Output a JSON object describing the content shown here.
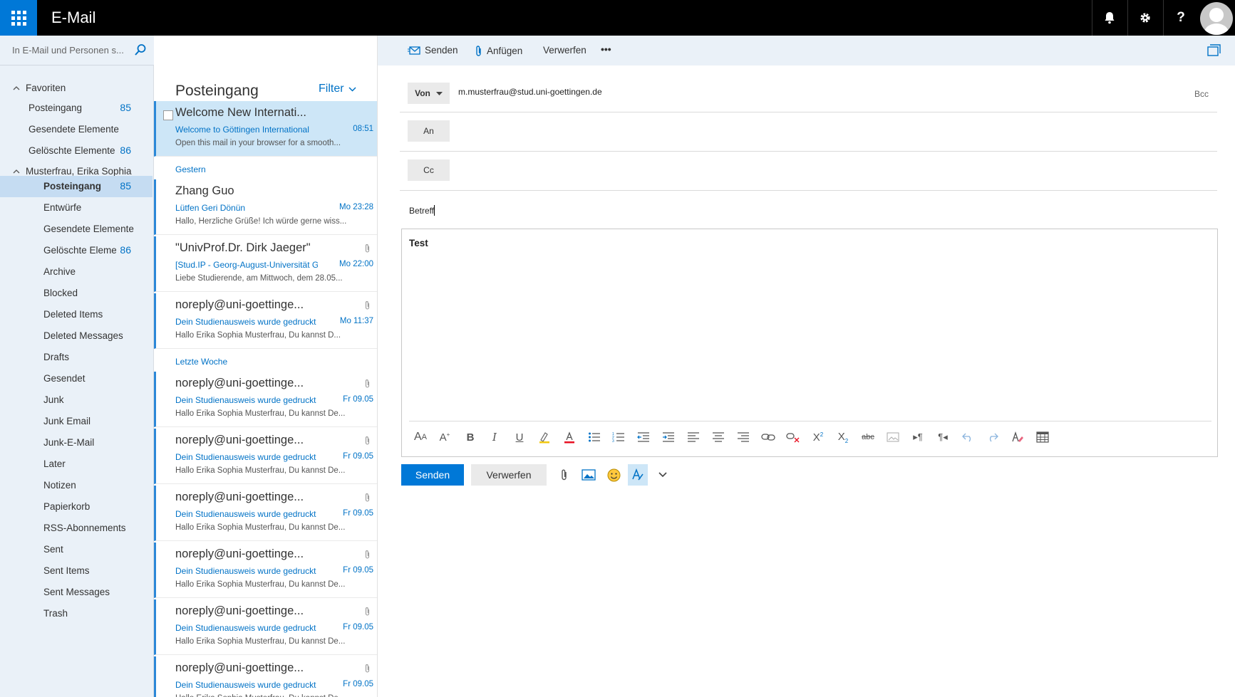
{
  "header": {
    "app_title": "E-Mail"
  },
  "search": {
    "placeholder": "In E-Mail und Personen s..."
  },
  "sidebar": {
    "favorites_label": "Favoriten",
    "favorites": [
      {
        "label": "Posteingang",
        "count": "85"
      },
      {
        "label": "Gesendete Elemente",
        "count": ""
      },
      {
        "label": "Gelöschte Elemente",
        "count": "86"
      }
    ],
    "account_label": "Musterfrau, Erika Sophia",
    "folders": [
      {
        "label": "Posteingang",
        "count": "85"
      },
      {
        "label": "Entwürfe",
        "count": ""
      },
      {
        "label": "Gesendete Elemente",
        "count": ""
      },
      {
        "label": "Gelöschte Elemente",
        "count": "86"
      },
      {
        "label": "Archive",
        "count": ""
      },
      {
        "label": "Blocked",
        "count": ""
      },
      {
        "label": "Deleted Items",
        "count": ""
      },
      {
        "label": "Deleted Messages",
        "count": ""
      },
      {
        "label": "Drafts",
        "count": ""
      },
      {
        "label": "Gesendet",
        "count": ""
      },
      {
        "label": "Junk",
        "count": ""
      },
      {
        "label": "Junk Email",
        "count": ""
      },
      {
        "label": "Junk-E-Mail",
        "count": ""
      },
      {
        "label": "Later",
        "count": ""
      },
      {
        "label": "Notizen",
        "count": ""
      },
      {
        "label": "Papierkorb",
        "count": ""
      },
      {
        "label": "RSS-Abonnements",
        "count": ""
      },
      {
        "label": "Sent",
        "count": ""
      },
      {
        "label": "Sent Items",
        "count": ""
      },
      {
        "label": "Sent Messages",
        "count": ""
      },
      {
        "label": "Trash",
        "count": ""
      }
    ]
  },
  "message_list": {
    "title": "Posteingang",
    "filter_label": "Filter",
    "section_yesterday": "Gestern",
    "section_last_week": "Letzte Woche",
    "messages": [
      {
        "from": "Welcome New Internati...",
        "subject": "Welcome to Göttingen International",
        "time": "08:51",
        "preview": "Open this mail in your browser for a smooth...",
        "attachment": false
      },
      {
        "from": "Zhang Guo",
        "subject": "Lütfen Geri Dönün",
        "time": "Mo 23:28",
        "preview": "Hallo, Herzliche Grüße! Ich würde gerne wiss...",
        "attachment": false
      },
      {
        "from": "\"UnivProf.Dr. Dirk Jaeger\"",
        "subject": "[Stud.IP - Georg-August-Universität G",
        "time": "Mo 22:00",
        "preview": "Liebe Studierende, am Mittwoch, dem 28.05...",
        "attachment": true
      },
      {
        "from": "noreply@uni-goettinge...",
        "subject": "Dein Studienausweis wurde gedruckt",
        "time": "Mo 11:37",
        "preview": "Hallo Erika Sophia Musterfrau, Du kannst D...",
        "attachment": true
      },
      {
        "from": "noreply@uni-goettinge...",
        "subject": "Dein Studienausweis wurde gedruckt",
        "time": "Fr 09.05",
        "preview": "Hallo Erika Sophia Musterfrau, Du kannst De...",
        "attachment": true
      },
      {
        "from": "noreply@uni-goettinge...",
        "subject": "Dein Studienausweis wurde gedruckt",
        "time": "Fr 09.05",
        "preview": "Hallo Erika Sophia Musterfrau, Du kannst De...",
        "attachment": true
      },
      {
        "from": "noreply@uni-goettinge...",
        "subject": "Dein Studienausweis wurde gedruckt",
        "time": "Fr 09.05",
        "preview": "Hallo Erika Sophia Musterfrau, Du kannst De...",
        "attachment": true
      },
      {
        "from": "noreply@uni-goettinge...",
        "subject": "Dein Studienausweis wurde gedruckt",
        "time": "Fr 09.05",
        "preview": "Hallo Erika Sophia Musterfrau, Du kannst De...",
        "attachment": true
      },
      {
        "from": "noreply@uni-goettinge...",
        "subject": "Dein Studienausweis wurde gedruckt",
        "time": "Fr 09.05",
        "preview": "Hallo Erika Sophia Musterfrau, Du kannst De...",
        "attachment": true
      },
      {
        "from": "noreply@uni-goettinge...",
        "subject": "Dein Studienausweis wurde gedruckt",
        "time": "Fr 09.05",
        "preview": "Hallo Erika Sophia Musterfrau, Du kannst De...",
        "attachment": true
      }
    ]
  },
  "compose_toolbar": {
    "send": "Senden",
    "attach": "Anfügen",
    "discard": "Verwerfen",
    "more": "•••"
  },
  "compose": {
    "from_label": "Von",
    "from_address": "m.musterfrau@stud.uni-goettingen.de",
    "bcc_label": "Bcc",
    "to_label": "An",
    "cc_label": "Cc",
    "subject_value": "Betreff",
    "body_text": "Test",
    "send_button": "Senden",
    "discard_button": "Verwerfen"
  },
  "colors": {
    "accent": "#0078d7",
    "link": "#0072c6",
    "selected_bg": "#cde6f7",
    "nav_bg": "#eaf1f8"
  }
}
